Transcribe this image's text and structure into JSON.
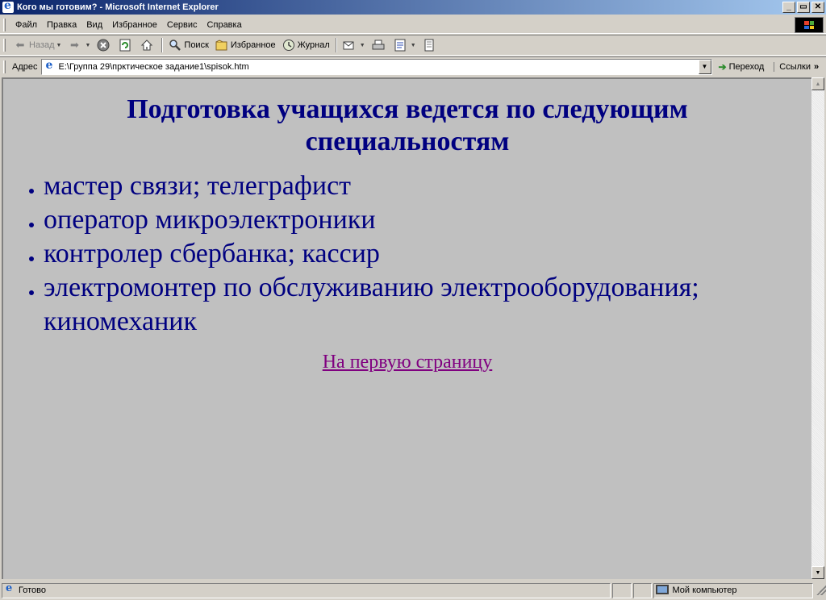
{
  "window": {
    "title": "Кого мы готовим? - Microsoft Internet Explorer",
    "min_glyph": "_",
    "max_glyph": "▭",
    "close_glyph": "✕"
  },
  "menu": {
    "items": [
      {
        "label": "Файл"
      },
      {
        "label": "Правка"
      },
      {
        "label": "Вид"
      },
      {
        "label": "Избранное"
      },
      {
        "label": "Сервис"
      },
      {
        "label": "Справка"
      }
    ]
  },
  "toolbar": {
    "back_label": "Назад",
    "search_label": "Поиск",
    "favorites_label": "Избранное",
    "history_label": "Журнал",
    "icons": {
      "back": "arrow-left-icon",
      "forward": "arrow-right-icon",
      "stop": "stop-icon",
      "refresh": "refresh-icon",
      "home": "home-icon",
      "search": "search-icon",
      "favorites": "favorites-icon",
      "history": "history-icon",
      "mail": "mail-icon",
      "print": "print-icon",
      "edit": "edit-icon",
      "discuss": "discuss-icon"
    }
  },
  "address": {
    "label": "Адрес",
    "value": "E:\\Группа 29\\прктическое задание1\\spisok.htm",
    "go_label": "Переход",
    "links_label": "Ссылки"
  },
  "page": {
    "heading": "Подготовка учащихся ведется по следующим специальностям",
    "items": [
      "мастер связи; телеграфист",
      "оператор микроэлектроники",
      "контролер сбербанка; кассир",
      "электромонтер по обслуживанию электрооборудования; киномеханик"
    ],
    "back_link": "На первую страницу",
    "background": "#c0c0c0",
    "text_color": "#000080",
    "visited_link_color": "#800080"
  },
  "status": {
    "text": "Готово",
    "zone": "Мой компьютер"
  }
}
